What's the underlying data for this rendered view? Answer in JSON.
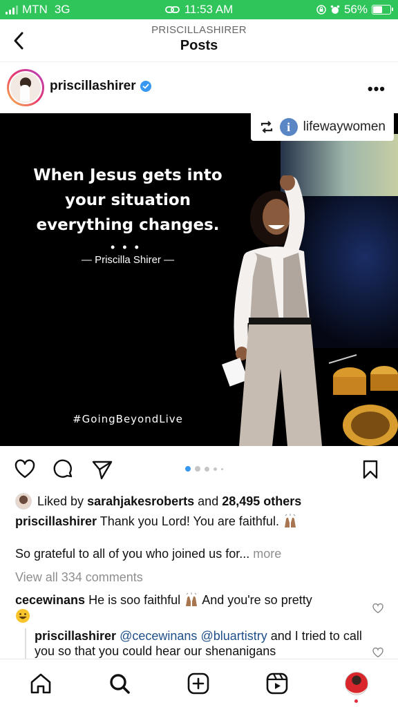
{
  "status": {
    "carrier": "MTN",
    "network": "3G",
    "time": "11:53 AM",
    "battery": "56%",
    "battery_level": 0.56,
    "color": "#2fc55a"
  },
  "header": {
    "account": "PRISCILLASHIRER",
    "title": "Posts"
  },
  "post": {
    "username": "priscillashirer",
    "repost_user": "lifewaywomen",
    "quote": "When Jesus gets into your situation everything changes.",
    "quote_dots": "• • •",
    "attribution": "— Priscilla Shirer —",
    "hashtag": "#GoingBeyondLive",
    "carousel": {
      "count": 5,
      "active": 1
    }
  },
  "likes": {
    "prefix": "Liked by",
    "user": "sarahjakesroberts",
    "middle": "and",
    "others": "28,495 others"
  },
  "caption": {
    "user": "priscillashirer",
    "text": "Thank you Lord! You are faithful.",
    "text2": "So grateful to all of you who joined us for...",
    "more": "more"
  },
  "comments": {
    "view_all": "View all 334 comments",
    "c1_user": "cecewinans",
    "c1_text_a": "He is soo faithful",
    "c1_text_b": "And you're so pretty",
    "r1_user": "priscillashirer",
    "r1_mention1": "@cecewinans",
    "r1_mention2": "@bluartistry",
    "r1_text": "and I tried to call you so that you could hear our shenanigans"
  },
  "icons": {
    "like": "heart-icon",
    "comment": "comment-icon",
    "share": "send-icon",
    "save": "bookmark-icon"
  }
}
